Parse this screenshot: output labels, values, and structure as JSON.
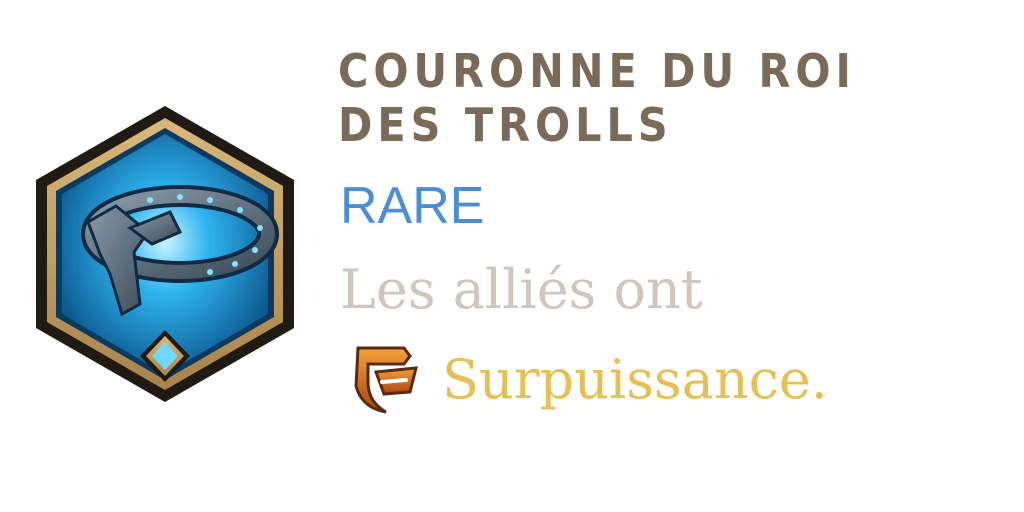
{
  "item": {
    "name": "COURONNE DU ROI DES TROLLS",
    "rarity": "RARE",
    "description": "Les alliés ont",
    "keyword": "Surpuissance.",
    "icon": "troll-king-crown-icon"
  },
  "colors": {
    "title": "#7a6b58",
    "rarity": "#4a8fd6",
    "description": "#cfc7bd",
    "keyword": "#e6bf55",
    "frame_gold": "#c9a56a",
    "glow_blue": "#2fb5f0"
  },
  "keyword_icon": "overpower-shield-icon"
}
